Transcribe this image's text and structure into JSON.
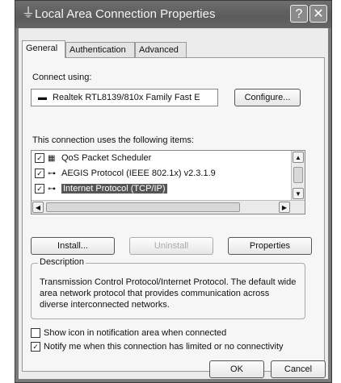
{
  "window": {
    "title": "Local Area Connection Properties",
    "help_button": "?",
    "close_button": "✕"
  },
  "tabs": [
    {
      "label": "General",
      "active": true
    },
    {
      "label": "Authentication",
      "active": false
    },
    {
      "label": "Advanced",
      "active": false
    }
  ],
  "connect_using": {
    "label": "Connect using:",
    "device": "Realtek RTL8139/810x Family Fast E",
    "configure_button": "Configure..."
  },
  "items_section": {
    "label": "This connection uses the following items:",
    "items": [
      {
        "label": "QoS Packet Scheduler",
        "checked": true,
        "selected": false,
        "icon": "scheduler-icon"
      },
      {
        "label": "AEGIS Protocol (IEEE 802.1x) v2.3.1.9",
        "checked": true,
        "selected": false,
        "icon": "protocol-icon"
      },
      {
        "label": "Internet Protocol (TCP/IP)",
        "checked": true,
        "selected": true,
        "icon": "protocol-icon"
      }
    ]
  },
  "buttons": {
    "install": "Install...",
    "uninstall": "Uninstall",
    "properties": "Properties"
  },
  "description": {
    "legend": "Description",
    "text": "Transmission Control Protocol/Internet Protocol. The default wide area network protocol that provides communication across diverse interconnected networks."
  },
  "options": {
    "show_icon": {
      "label": "Show icon in notification area when connected",
      "checked": false
    },
    "notify": {
      "label": "Notify me when this connection has limited or no connectivity",
      "checked": true
    }
  },
  "footer": {
    "ok": "OK",
    "cancel": "Cancel"
  }
}
